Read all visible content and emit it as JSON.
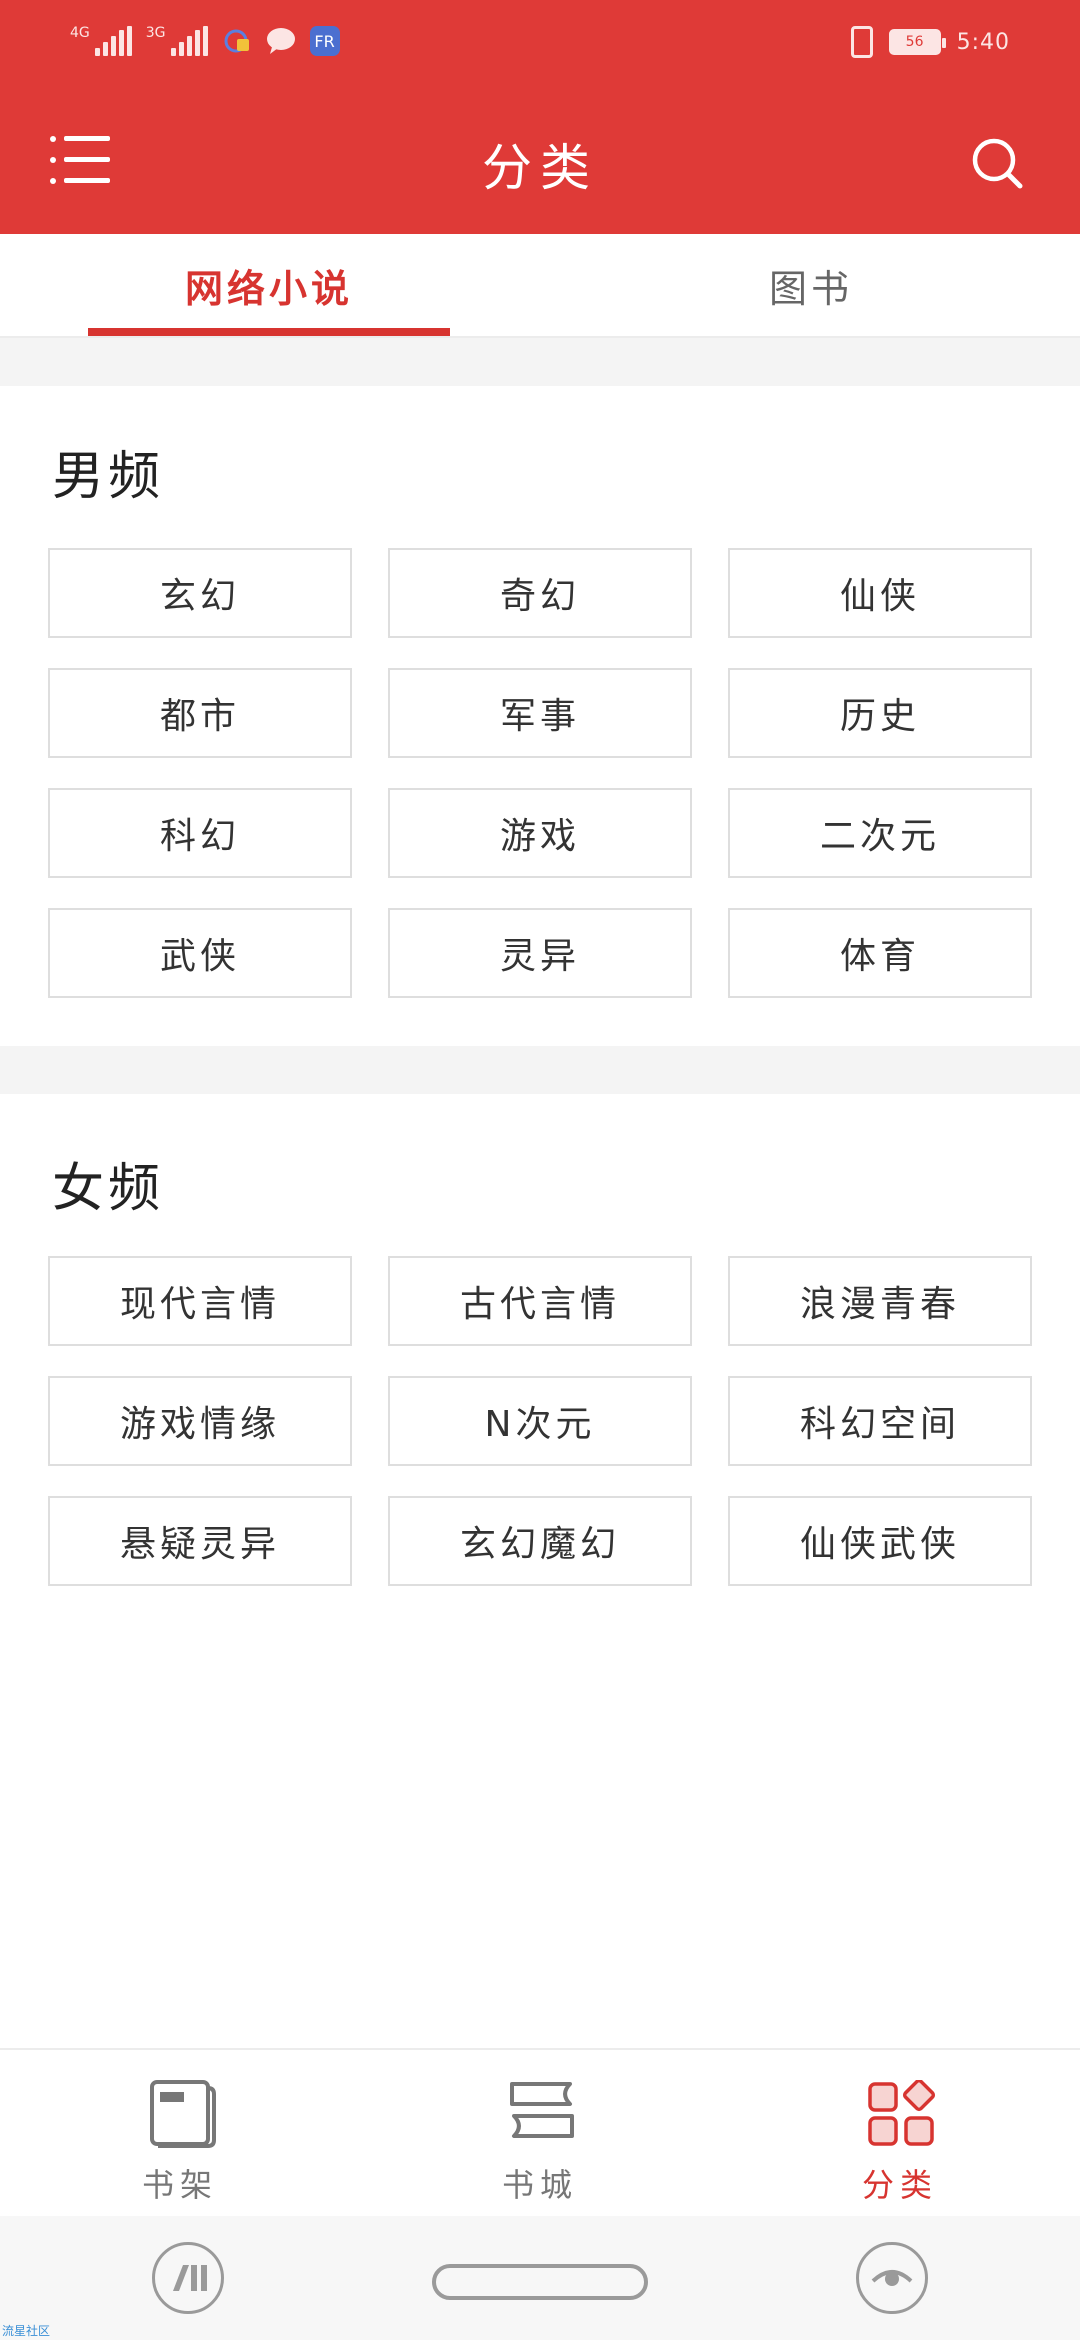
{
  "status_bar": {
    "net1": "4G",
    "net2": "3G",
    "battery": "56",
    "time": "5:40",
    "app_badge": "FR"
  },
  "app_bar": {
    "title": "分类"
  },
  "tabs": [
    {
      "label": "网络小说",
      "active": true
    },
    {
      "label": "图书",
      "active": false
    }
  ],
  "male_section": {
    "title": "男频",
    "items": [
      "玄幻",
      "奇幻",
      "仙侠",
      "都市",
      "军事",
      "历史",
      "科幻",
      "游戏",
      "二次元",
      "武侠",
      "灵异",
      "体育"
    ]
  },
  "female_section": {
    "title": "女频",
    "items": [
      "现代言情",
      "古代言情",
      "浪漫青春",
      "游戏情缘",
      "N次元",
      "科幻空间",
      "悬疑灵异",
      "玄幻魔幻",
      "仙侠武侠"
    ]
  },
  "bottom_nav": [
    {
      "label": "书架",
      "icon": "bookshelf-icon"
    },
    {
      "label": "书城",
      "icon": "bookstore-icon"
    },
    {
      "label": "分类",
      "icon": "category-icon",
      "active": true
    }
  ],
  "colors": {
    "brand": "#df3a37",
    "accent": "#d73430"
  },
  "watermark": "流星社区"
}
